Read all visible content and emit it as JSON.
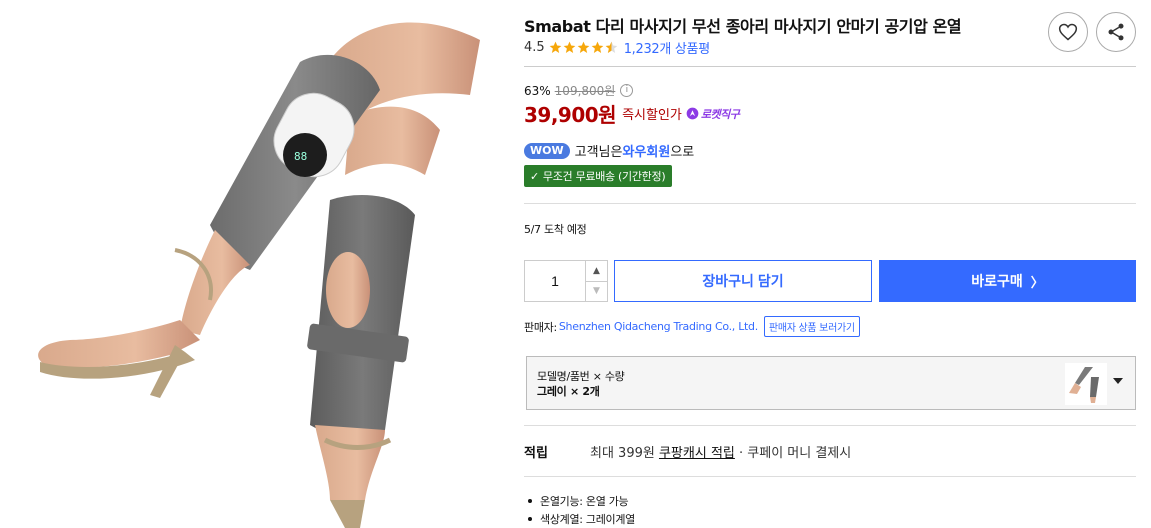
{
  "product": {
    "title": "Smabat 다리 마사지기 무선 종아리 마사지기 안마기 공기압 온열",
    "rating": "4.5",
    "stars": 4.5,
    "review_count": "1,232개 상품평"
  },
  "price": {
    "discount_pct": "63%",
    "original": "109,800원",
    "sale": "39,900원",
    "sale_label": "즉시할인가",
    "info_icon": "ⓘ",
    "rocket_badge": "로켓직구"
  },
  "membership": {
    "badge": "WOW",
    "prefix": "고객님은 ",
    "link": "와우회원",
    "suffix": "으로",
    "free_shipping": "무조건 무료배송 (기간한정)"
  },
  "delivery": {
    "date": "5/7 도착 예정"
  },
  "purchase": {
    "quantity": "1",
    "cart_label": "장바구니 담기",
    "buy_label": "바로구매",
    "buy_chevron": "〉"
  },
  "seller": {
    "label": "판매자: ",
    "name": "Shenzhen Qidacheng Trading Co., Ltd.",
    "more_label": "판매자 상품 보러가기"
  },
  "option": {
    "label": "모델명/품번 × 수량",
    "value": "그레이 × 2개"
  },
  "reward": {
    "label": "적립",
    "prefix": "최대 399원 ",
    "link": "쿠팡캐시 적립",
    "suffix": " · 쿠페이 머니 결제시"
  },
  "specs": [
    "온열기능: 온열 가능",
    "색상계열: 그레이계열"
  ],
  "colors": {
    "accent_blue": "#346aff",
    "price_red": "#ae0000",
    "free_ship_green": "#2a7d2a",
    "rocket_purple": "#8c3ae5",
    "star_gold": "#f6a70b"
  }
}
